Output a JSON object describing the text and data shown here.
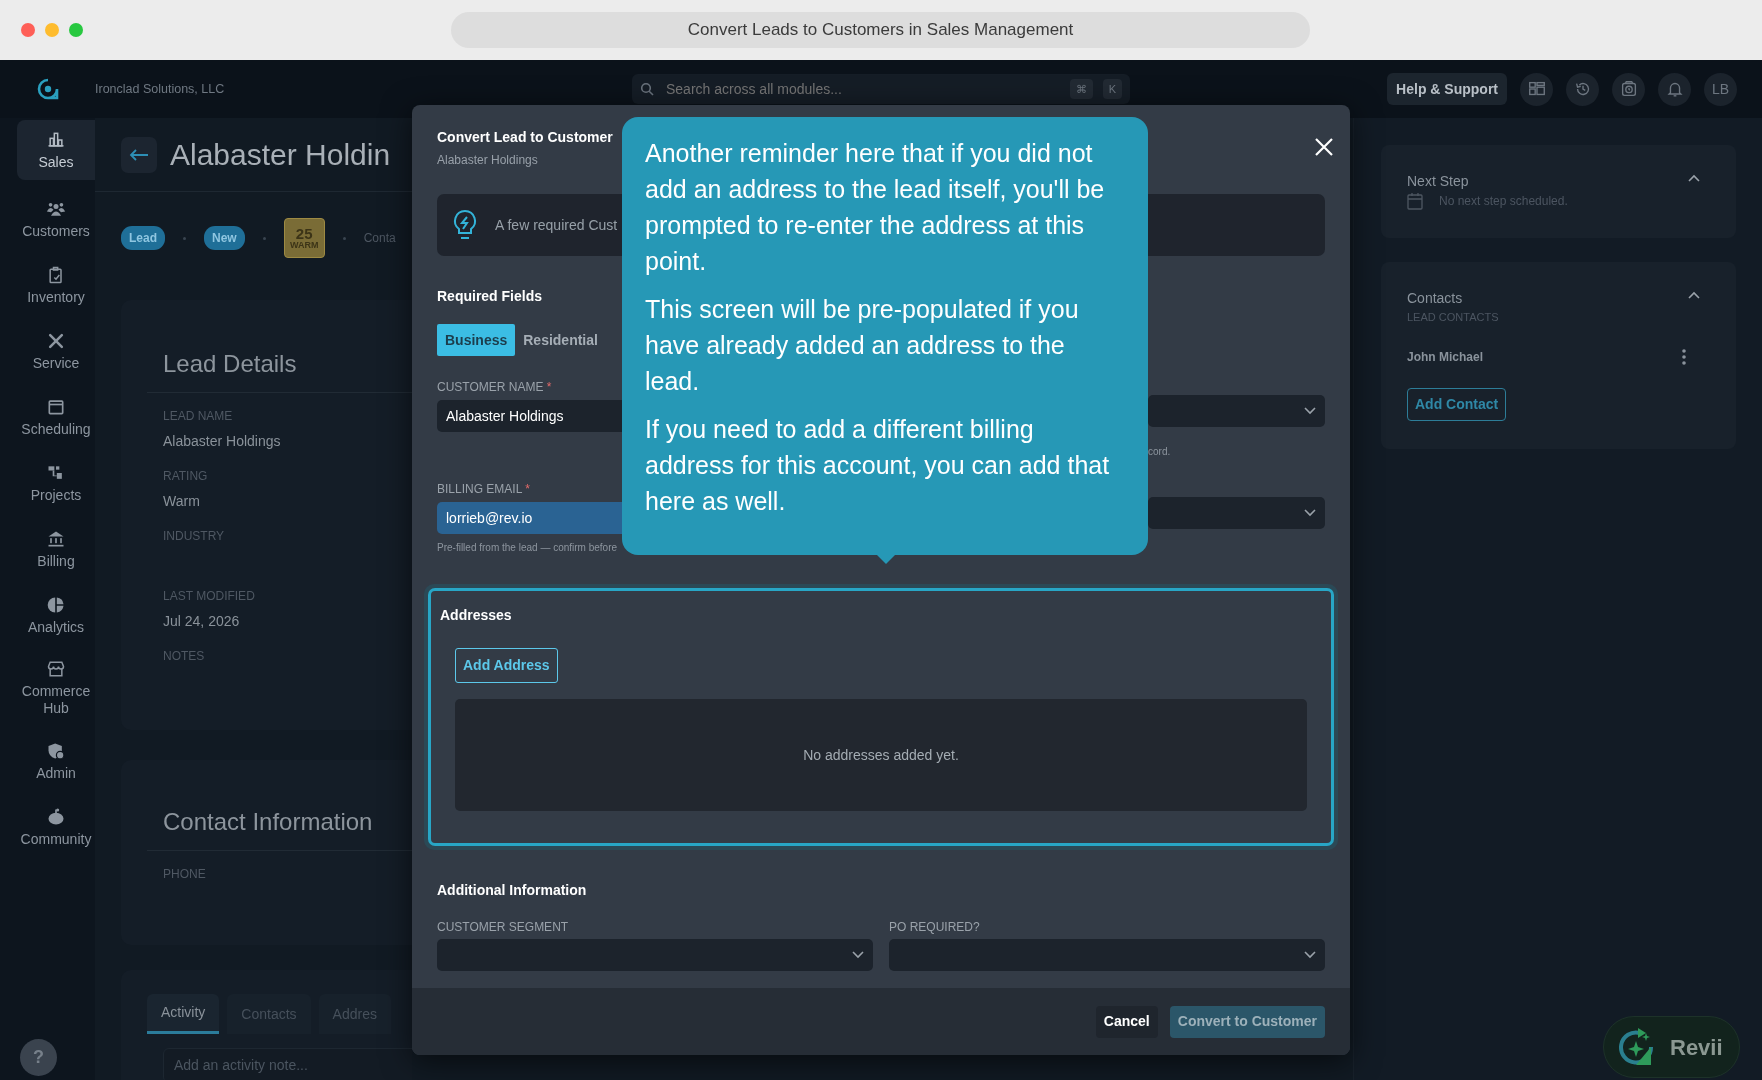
{
  "window": {
    "title": "Convert Leads to Customers in Sales Management"
  },
  "header": {
    "company": "Ironclad Solutions, LLC",
    "search": {
      "placeholder": "Search across all modules...",
      "keys": [
        "⌘",
        "K"
      ]
    },
    "help_button": "Help & Support",
    "avatar": "LB"
  },
  "sidebar": {
    "items": [
      {
        "label": "Sales",
        "selected": true
      },
      {
        "label": "Customers",
        "selected": false
      },
      {
        "label": "Inventory",
        "selected": false
      },
      {
        "label": "Service",
        "selected": false
      },
      {
        "label": "Scheduling",
        "selected": false
      },
      {
        "label": "Projects",
        "selected": false
      },
      {
        "label": "Billing",
        "selected": false
      },
      {
        "label": "Analytics",
        "selected": false
      },
      {
        "label": "Commerce Hub",
        "selected": false
      },
      {
        "label": "Admin",
        "selected": false
      },
      {
        "label": "Community",
        "selected": false
      }
    ],
    "help": "?"
  },
  "lead": {
    "title": "Alabaster Holdin",
    "badges": [
      "Lead",
      "New"
    ],
    "score": {
      "value": "25",
      "label": "WARM"
    },
    "meta": "Conta"
  },
  "lead_details": {
    "title": "Lead Details",
    "fields": [
      {
        "label": "LEAD NAME",
        "value": "Alabaster Holdings"
      },
      {
        "label": "RATING",
        "value": "Warm"
      },
      {
        "label": "INDUSTRY"
      },
      {
        "label": "LAST MODIFIED",
        "value": "Jul 24, 2026"
      },
      {
        "label": "NOTES"
      }
    ]
  },
  "contact_information": {
    "title": "Contact Information",
    "fields": [
      {
        "label": "PHONE"
      }
    ]
  },
  "activity": {
    "tabs": [
      {
        "label": "Activity",
        "selected": true
      },
      {
        "label": "Contacts",
        "selected": false
      },
      {
        "label": "Addres",
        "selected": false
      }
    ],
    "note": {
      "placeholder": "Add an activity note..."
    }
  },
  "right_panel": {
    "next_step": {
      "title": "Next Step",
      "text": "No next step scheduled.",
      "expanded": true
    },
    "contacts": {
      "title": "Contacts",
      "subtitle": "LEAD CONTACTS",
      "expanded": true,
      "items": [
        {
          "name": "John Michael"
        }
      ],
      "add_button": "Add Contact"
    }
  },
  "modal": {
    "title": "Convert Lead to Customer",
    "subtitle": "Alabaster Holdings",
    "info": "A few required Cust",
    "required_fields": {
      "title": "Required Fields",
      "types": [
        {
          "label": "Business",
          "selected": true
        },
        {
          "label": "Residential",
          "selected": false
        }
      ],
      "customer_name": {
        "label": "CUSTOMER NAME",
        "required_mark": "*",
        "value": "Alabaster Holdings"
      },
      "column_2": [
        {
          "kind": "select",
          "hint": "cord."
        },
        {
          "kind": "select"
        }
      ],
      "billing_email": {
        "label": "BILLING EMAIL",
        "required_mark": "*",
        "value": "lorrieb@rev.io",
        "hint": "Pre-filled from the lead — confirm before"
      }
    },
    "addresses": {
      "title": "Addresses",
      "highlighted": true,
      "add_button": "Add Address",
      "empty": "No addresses added yet."
    },
    "additional": {
      "title": "Additional Information",
      "fields": [
        {
          "label": "CUSTOMER SEGMENT"
        },
        {
          "label": "PO REQUIRED?"
        }
      ]
    },
    "buttons": [
      {
        "label": "Cancel",
        "kind": "secondary"
      },
      {
        "label": "Convert to Customer",
        "kind": "primary"
      }
    ]
  },
  "tooltip": {
    "paragraphs": [
      "Another reminder here that if you did not add an address to the lead itself, you'll be prompted to re-enter the address at this point.",
      "This screen will be pre-populated if you have already added an address to the lead.",
      "If you need to add a different billing address for this account, you can add that here as well."
    ]
  },
  "assistant": {
    "label": "Revii"
  }
}
